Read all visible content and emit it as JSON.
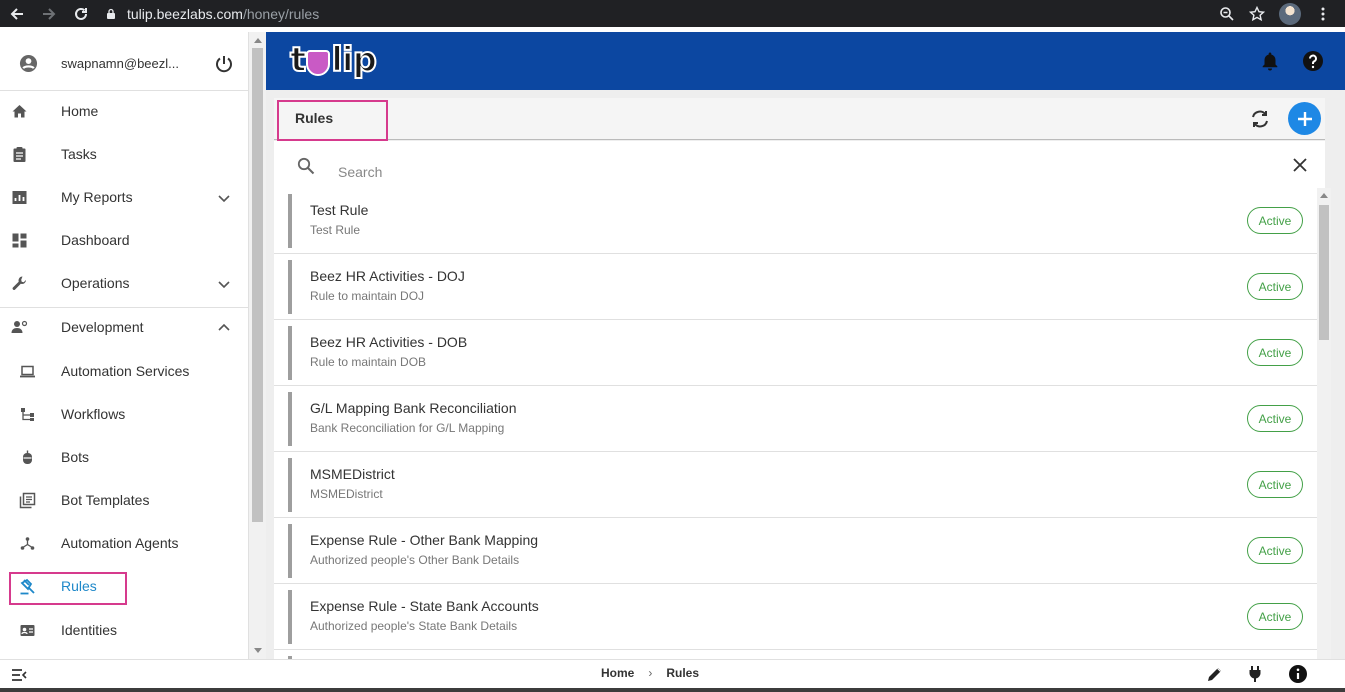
{
  "browser": {
    "url_host": "tulip.beezlabs.com",
    "url_path": "/honey/rules"
  },
  "user": {
    "email": "swapnamn@beezl..."
  },
  "sidebar": {
    "items": [
      {
        "label": "Home"
      },
      {
        "label": "Tasks"
      },
      {
        "label": "My Reports"
      },
      {
        "label": "Dashboard"
      },
      {
        "label": "Operations"
      },
      {
        "label": "Development"
      },
      {
        "label": "Automation Services"
      },
      {
        "label": "Workflows"
      },
      {
        "label": "Bots"
      },
      {
        "label": "Bot Templates"
      },
      {
        "label": "Automation Agents"
      },
      {
        "label": "Rules"
      },
      {
        "label": "Identities"
      }
    ]
  },
  "header": {
    "logo_text_1": "t",
    "logo_text_2": "lip"
  },
  "panel": {
    "title": "Rules"
  },
  "search": {
    "placeholder": "Search",
    "value": ""
  },
  "rules": [
    {
      "name": "Test Rule",
      "description": "Test Rule",
      "status": "Active"
    },
    {
      "name": "Beez HR Activities - DOJ",
      "description": "Rule to maintain DOJ",
      "status": "Active"
    },
    {
      "name": "Beez HR Activities - DOB",
      "description": "Rule to maintain DOB",
      "status": "Active"
    },
    {
      "name": "G/L Mapping Bank Reconciliation",
      "description": "Bank Reconciliation for G/L Mapping",
      "status": "Active"
    },
    {
      "name": "MSMEDistrict",
      "description": "MSMEDistrict",
      "status": "Active"
    },
    {
      "name": "Expense Rule - Other Bank Mapping",
      "description": "Authorized people's Other Bank Details",
      "status": "Active"
    },
    {
      "name": "Expense Rule - State Bank Accounts",
      "description": "Authorized people's State Bank Details",
      "status": "Active"
    }
  ],
  "breadcrumb": {
    "home": "Home",
    "separator": "›",
    "current": "Rules"
  },
  "colors": {
    "header_bg": "#0c47a1",
    "accent": "#1e88e5",
    "active_status": "#43a047",
    "highlight_box": "#d63a8d"
  }
}
